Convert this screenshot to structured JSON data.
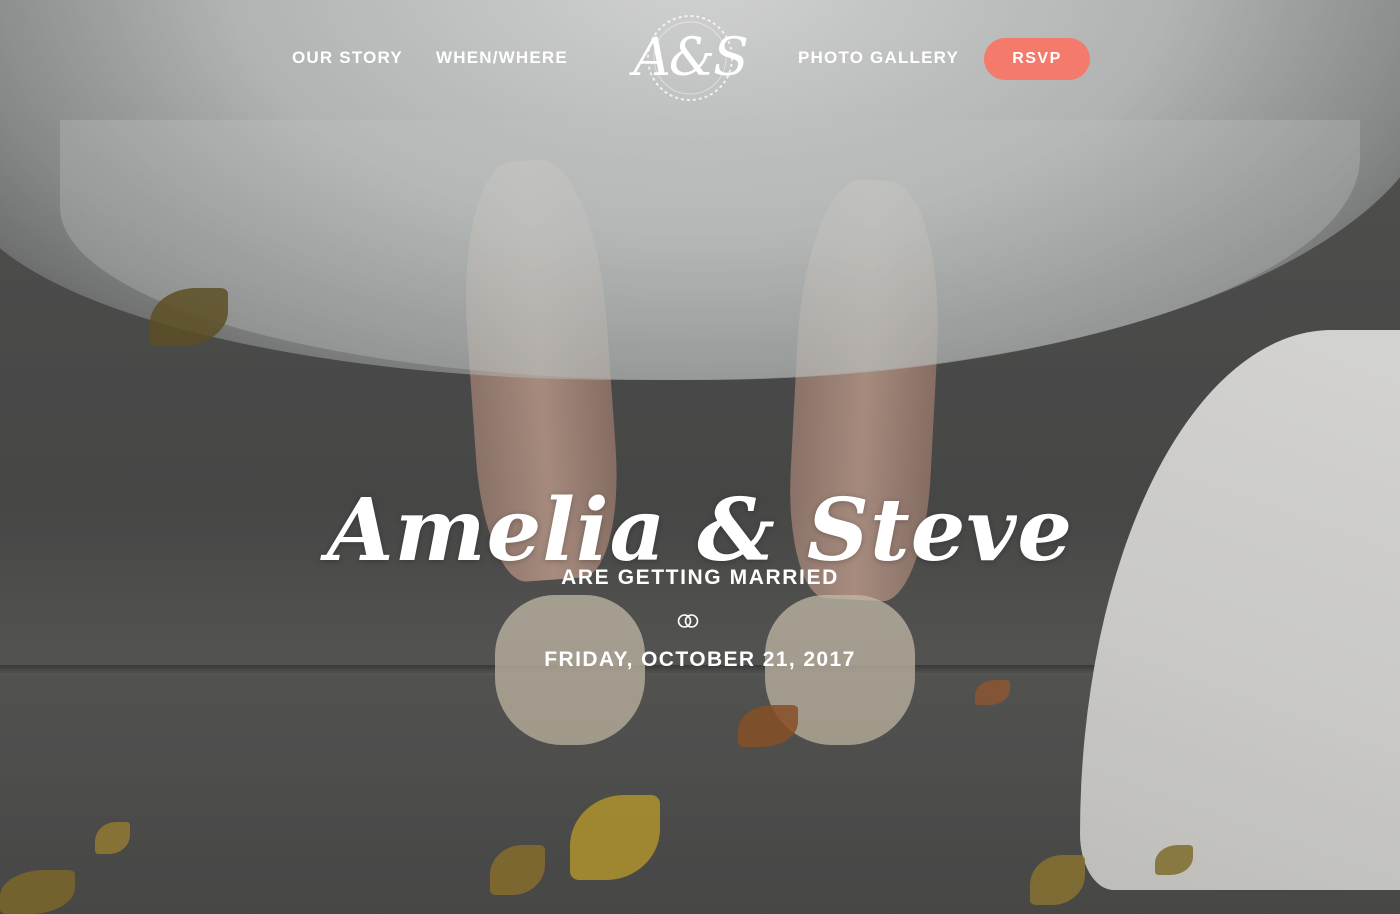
{
  "nav": {
    "links": [
      {
        "label": "OUR STORY"
      },
      {
        "label": "WHEN/WHERE"
      },
      {
        "label": "PHOTO GALLERY"
      }
    ],
    "logo_text": "A&S",
    "rsvp_label": "RSVP"
  },
  "hero": {
    "names": "Amelia & Steve",
    "subtitle": "ARE GETTING MARRIED",
    "divider_icon": "wedding-rings-icon",
    "date": "FRIDAY, OCTOBER 21, 2017"
  },
  "colors": {
    "accent": "#f47a6c",
    "text": "#ffffff"
  }
}
